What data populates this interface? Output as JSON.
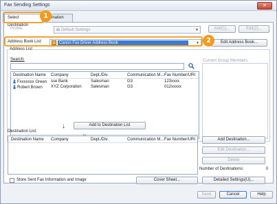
{
  "window": {
    "title": "Fax Sending Settings",
    "close_glyph": "✕"
  },
  "tabs": [
    {
      "label": "Select Destination"
    },
    {
      "label": "ination"
    }
  ],
  "callouts": [
    "1",
    "2"
  ],
  "profile": {
    "label": "Profile:",
    "value": "Default Settings",
    "add_label": "Add(1)...",
    "edit_label": "Edit(2)..."
  },
  "address_book": {
    "label": "Address Book List:",
    "value": "Canon Fax Driver Address Book",
    "edit_button": "Edit Address Book..."
  },
  "address_list": {
    "group_label": "Address List",
    "search_label": "Search:",
    "search_value": "",
    "columns": [
      "Destination Name",
      "Company",
      "Dept./Div.",
      "Communication M...",
      "Fax Number/URI"
    ],
    "rows": [
      [
        "Fxxxxxxx Green",
        "sse Bank",
        "Salesman",
        "G3",
        "123xxxx"
      ],
      [
        "Robert Brown",
        "XYZ Corporation",
        "Salesman",
        "G3",
        "012xxxxx"
      ]
    ],
    "scroll_marker": "III"
  },
  "current_group": {
    "label": "Current Group Members:"
  },
  "add_to_destination": {
    "label": "Add to Destination List",
    "arrow": "↓"
  },
  "destination_list": {
    "label": "Destination List:",
    "columns": [
      "Destination Name",
      "Company",
      "Dept./Div.",
      "Communication M...",
      "Fax Number/URI"
    ],
    "rows": []
  },
  "side_buttons": {
    "add": "Add Destination...",
    "edit": "Edit Destination...",
    "delete": "Delete"
  },
  "num_destinations": {
    "label": "Number of Destinations:",
    "value": "0"
  },
  "store_option": {
    "label": "Store Sent Fax Information and Image",
    "checked": false
  },
  "cover_sheet_button": "Cover Sheet...",
  "detailed_settings_button": "Detailed Settings(U)...",
  "footer": {
    "send": "Send",
    "cancel": "Cancel",
    "help": "Help"
  }
}
